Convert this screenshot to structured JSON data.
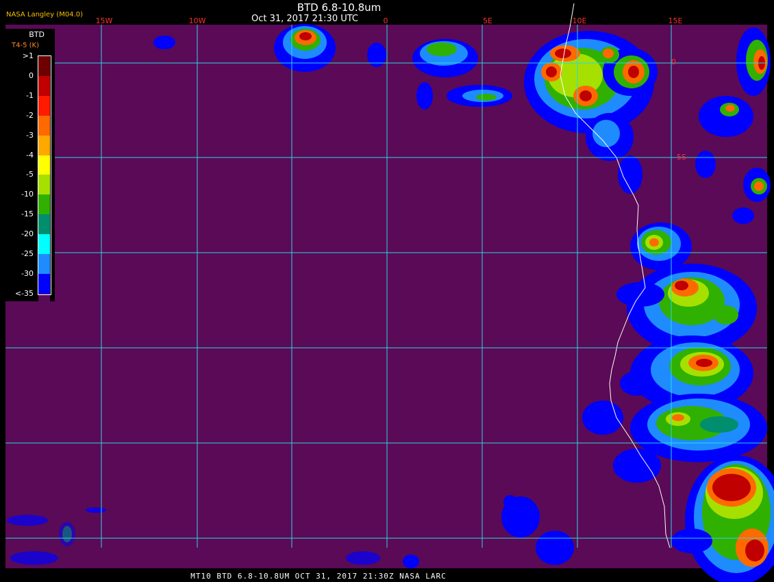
{
  "header": {
    "title": "BTD 6.8-10.8um",
    "datetime": "Oct 31, 2017 21:30 UTC",
    "organization": "NASA Langley (M04.0)"
  },
  "footer": {
    "caption": "MT10  BTD 6.8-10.8UM  OCT 31, 2017 21:30Z  NASA LARC"
  },
  "legend": {
    "title": "BTD",
    "units": "T4-5 (K)",
    "ticks": [
      ">1",
      "0",
      "-1",
      "-2",
      "-3",
      "-4",
      "-5",
      "-10",
      "-15",
      "-20",
      "-25",
      "-30",
      "<-35"
    ],
    "colors": [
      "#6e0000",
      "#c00000",
      "#ff1a00",
      "#ff6a00",
      "#ffa800",
      "#ffff00",
      "#a6e000",
      "#30b000",
      "#008e6e",
      "#00ffff",
      "#1e8cff",
      "#0000ff",
      "#5a0a56"
    ]
  },
  "map": {
    "background_color": "#5a0a56",
    "grid_color": "#2ad8e8",
    "coastline_color": "#ffffff",
    "longitude_labels": [
      "15W",
      "10W",
      "0",
      "5E",
      "10E",
      "15E"
    ],
    "latitude_labels": [
      "0",
      "5S"
    ]
  }
}
